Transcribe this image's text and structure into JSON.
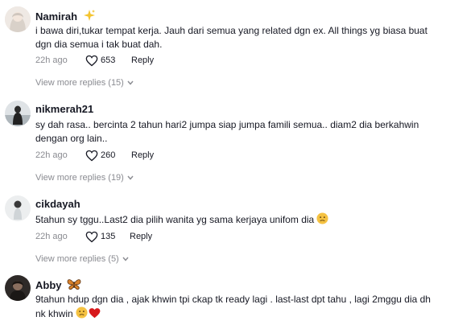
{
  "comments": [
    {
      "username": "Namirah",
      "badge": "sparkles",
      "text": "i bawa diri,tukar tempat kerja. Jauh dari semua yang related dgn ex. All things yg biasa buat dgn dia semua i tak buat dah.",
      "time": "22h ago",
      "likes": "653",
      "reply_label": "Reply",
      "more_replies": "View more replies (15)"
    },
    {
      "username": "nikmerah21",
      "text": "sy dah rasa.. bercinta 2 tahun hari2 jumpa siap jumpa famili semua.. diam2 dia berkahwin dengan org lain..",
      "time": "22h ago",
      "likes": "260",
      "reply_label": "Reply",
      "more_replies": "View more replies (19)"
    },
    {
      "username": "cikdayah",
      "text": "5tahun sy tggu..Last2 dia pilih wanita yg sama kerjaya unifom dia",
      "emoji": "sad-face",
      "time": "22h ago",
      "likes": "135",
      "reply_label": "Reply",
      "more_replies": "View more replies (5)"
    },
    {
      "username": "Abby",
      "badge": "butterfly",
      "text": "9tahun hdup dgn dia , ajak khwin tpi ckap tk ready lagi . last-last dpt tahu , lagi 2mggu dia dh nk khwin",
      "emojis": [
        "sad-face",
        "red-heart"
      ]
    }
  ],
  "colors": {
    "text": "#161823",
    "muted": "#8a8b91",
    "heart": "#d7191c"
  }
}
